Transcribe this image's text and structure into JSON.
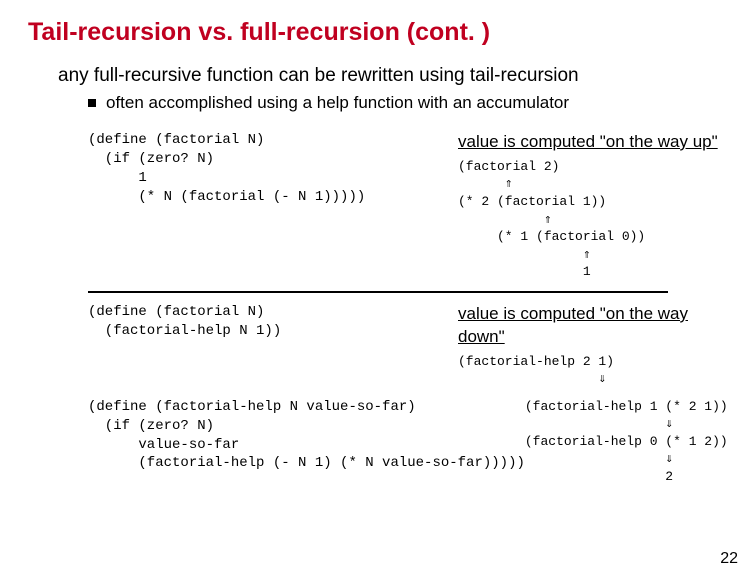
{
  "title": "Tail-recursion vs. full-recursion (cont. )",
  "lead": "any full-recursive function can be rewritten using tail-recursion",
  "bullet": "often accomplished using a help function with an accumulator",
  "code1": "(define (factorial N)\n  (if (zero? N)\n      1\n      (* N (factorial (- N 1)))))",
  "head1": "value is computed \"on the way up\"",
  "trace1": "(factorial 2)\n      ⇑\n(* 2 (factorial 1))\n           ⇑\n     (* 1 (factorial 0))\n                ⇑\n                1",
  "code2": "(define (factorial N)\n  (factorial-help N 1))",
  "head2": "value is computed \"on the way down\"",
  "trace2a": "(factorial-help 2 1)\n                  ⇓",
  "code3": "(define (factorial-help N value-so-far)\n  (if (zero? N)\n      value-so-far\n      (factorial-help (- N 1) (* N value-so-far)))))",
  "trace2b": "(factorial-help 1 (* 2 1))\n                  ⇓\n(factorial-help 0 (* 1 2))\n                  ⇓\n                  2",
  "pagenum": "22"
}
